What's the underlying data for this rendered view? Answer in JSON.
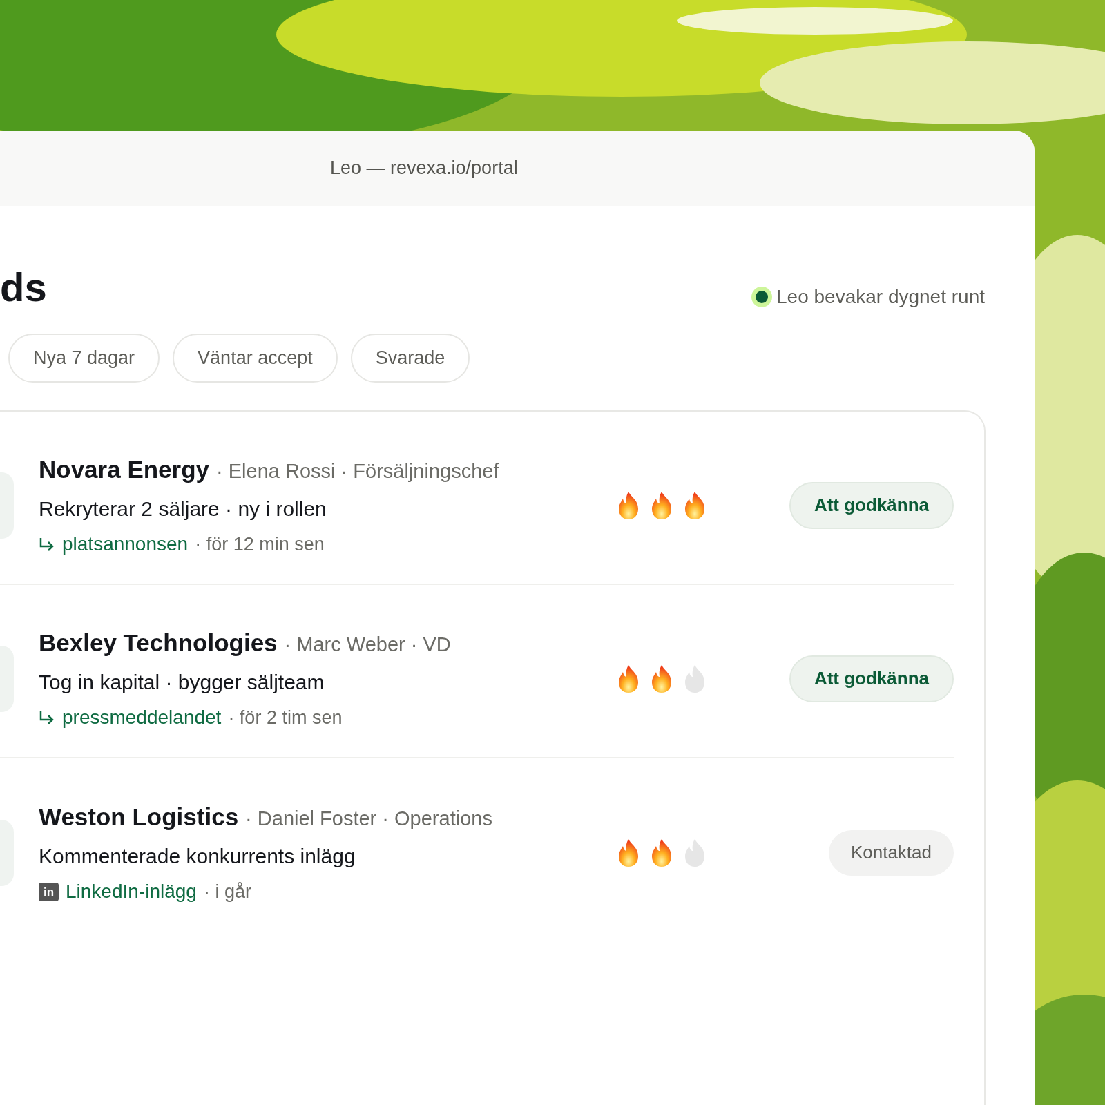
{
  "window": {
    "title": "Leo — revexa.io/portal"
  },
  "page": {
    "heading": "ds",
    "status": {
      "text": "Leo bevakar dygnet runt",
      "color": "#0b5a36"
    }
  },
  "filters": [
    {
      "label": "Nya 7 dagar",
      "selected": false
    },
    {
      "label": "Väntar accept",
      "selected": false
    },
    {
      "label": "Svarade",
      "selected": false
    }
  ],
  "leads": [
    {
      "company": "Novara Energy",
      "meta": "· Elena Rossi · Försäljningschef",
      "signal": "Rekryterar 2 säljare · ny i rollen",
      "source": {
        "kind": "link",
        "label": "platsannonsen",
        "time": "· för 12 min sen"
      },
      "stars": 3,
      "action": {
        "kind": "approve",
        "label": "Att godkänna"
      }
    },
    {
      "company": "Bexley Technologies",
      "meta": "· Marc Weber · VD",
      "signal": "Tog in kapital · bygger säljteam",
      "source": {
        "kind": "link",
        "label": "pressmeddelandet",
        "time": "· för 2 tim sen"
      },
      "stars": 2,
      "action": {
        "kind": "approve",
        "label": "Att godkänna"
      }
    },
    {
      "company": "Weston Logistics",
      "meta": "· Daniel Foster · Operations",
      "signal": "Kommenterade konkurrents inlägg",
      "source": {
        "kind": "linkedin",
        "badge": "in",
        "label": "LinkedIn-inlägg",
        "time": "· i går"
      },
      "stars": 2,
      "action": {
        "kind": "contacted",
        "label": "Kontaktad"
      }
    }
  ]
}
